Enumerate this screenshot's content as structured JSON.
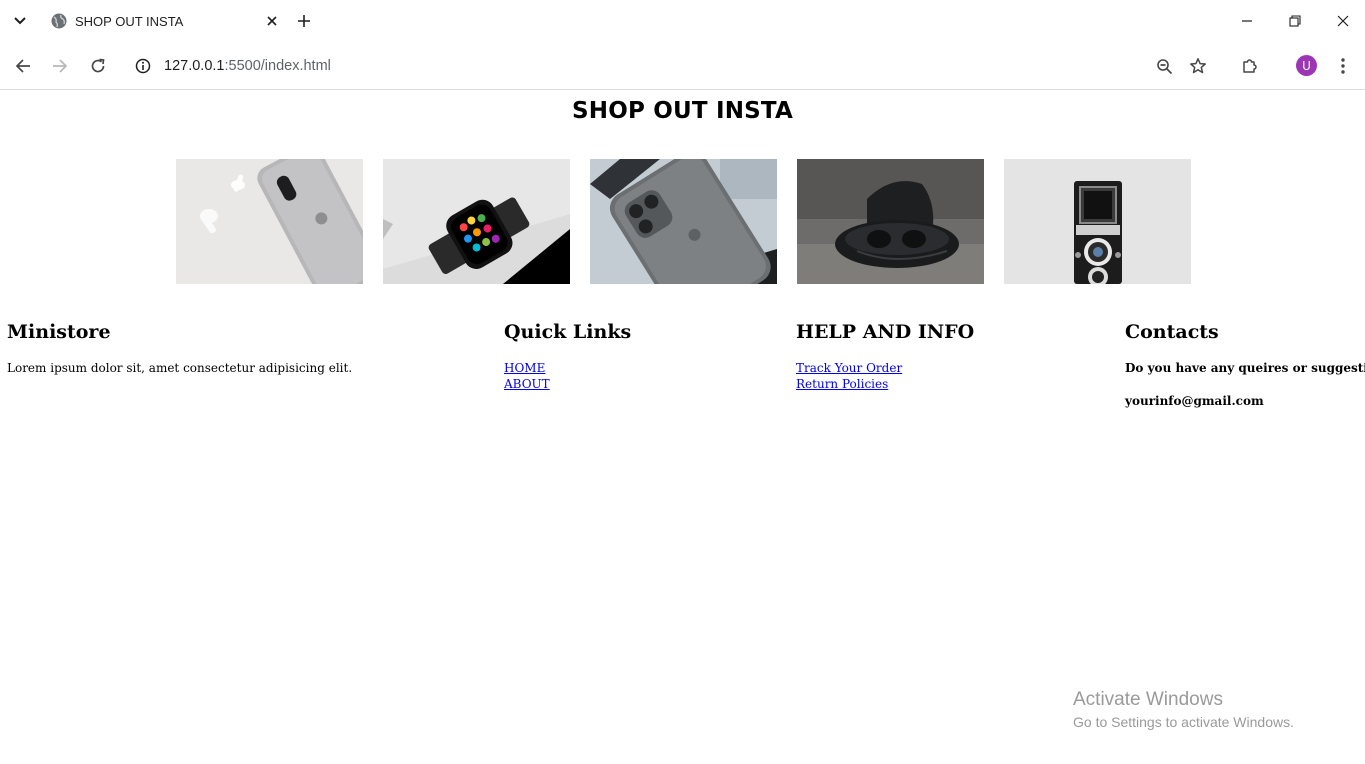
{
  "browser": {
    "tab_title": "SHOP OUT INSTA",
    "url_host": "127.0.0.1",
    "url_rest": ":5500/index.html",
    "profile_initial": "U"
  },
  "page": {
    "title": "SHOP OUT INSTA",
    "images": [
      {
        "name": "airpods-and-iphone-photo"
      },
      {
        "name": "smartwatch-photo"
      },
      {
        "name": "iphone-pro-photo"
      },
      {
        "name": "earbuds-case-photo"
      },
      {
        "name": "vintage-camera-photo"
      }
    ]
  },
  "footer": {
    "ministore": {
      "heading": "Ministore",
      "text": "Lorem ipsum dolor sit, amet consectetur adipisicing elit."
    },
    "quick_links": {
      "heading": "Quick Links",
      "links": [
        "HOME",
        "ABOUT"
      ]
    },
    "help": {
      "heading": "HELP AND INFO",
      "links": [
        "Track Your Order",
        "Return Policies"
      ]
    },
    "contacts": {
      "heading": "Contacts",
      "question": "Do you have any queires or suggestions",
      "email": "yourinfo@gmail.com"
    }
  },
  "os_watermark": {
    "line1": "Activate Windows",
    "line2": "Go to Settings to activate Windows."
  },
  "colors": {
    "link": "#0000ee",
    "avatar": "#9c36b5",
    "watermark": "#9a9a9a"
  }
}
